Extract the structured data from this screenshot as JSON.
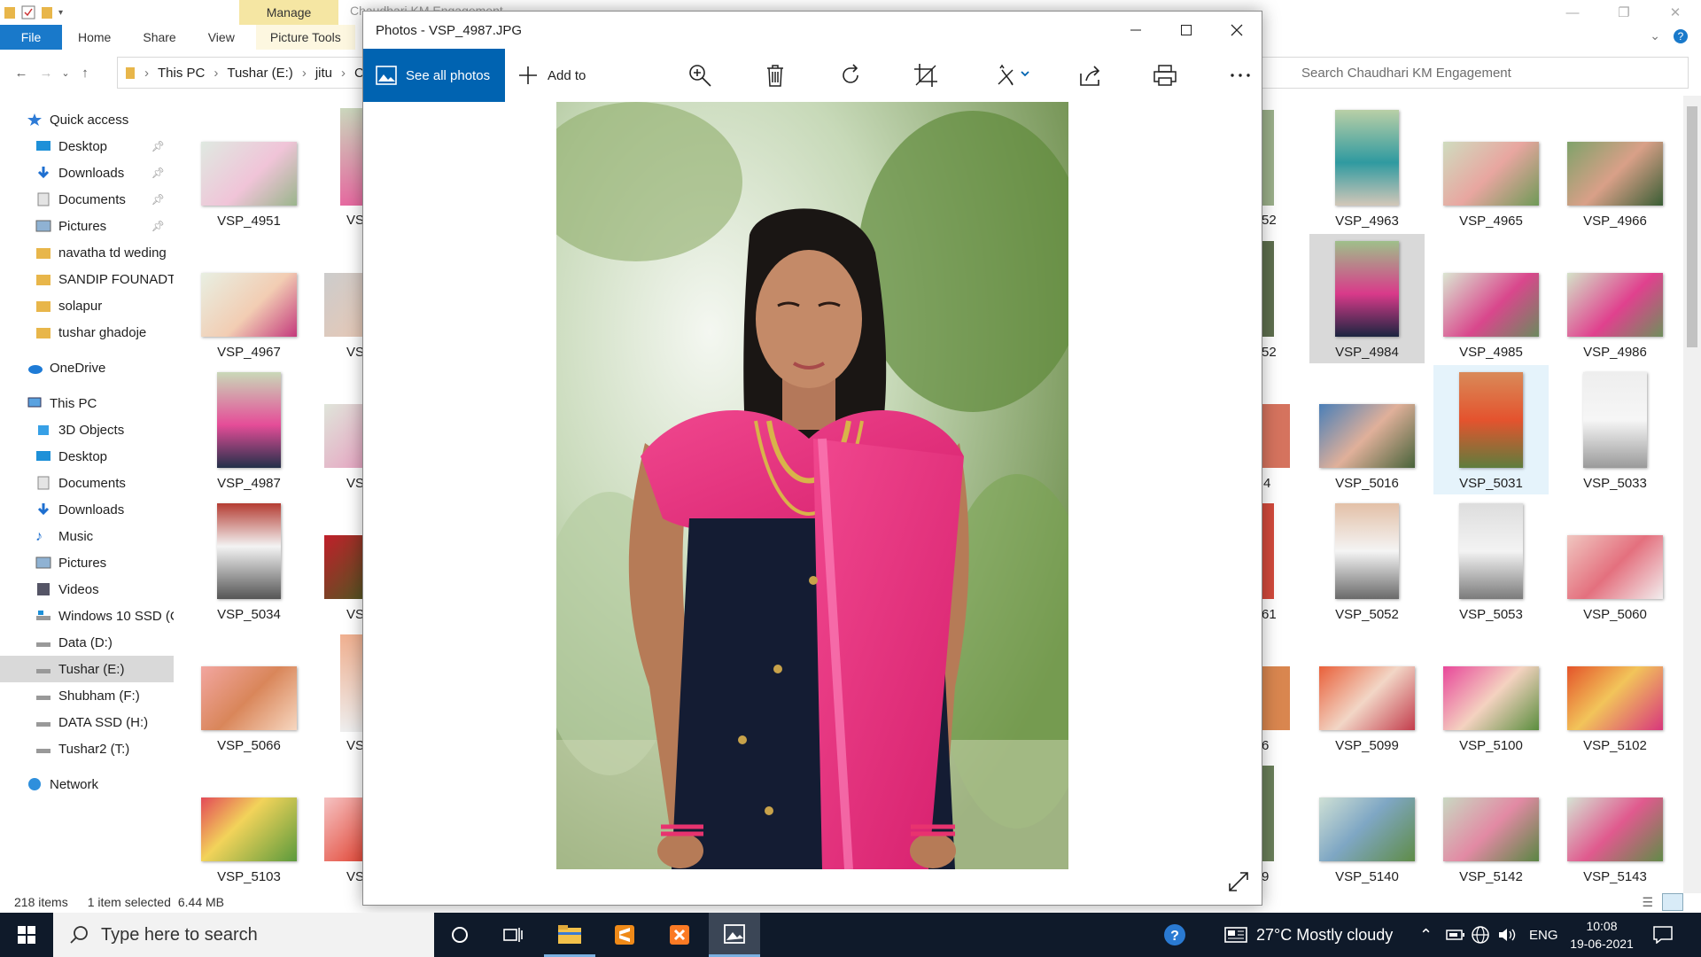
{
  "explorer": {
    "window_title": "Chaudhari KM Engagement",
    "ribbon": {
      "context_group": "Manage",
      "tabs": [
        "File",
        "Home",
        "Share",
        "View",
        "Picture Tools"
      ]
    },
    "address": [
      "This PC",
      "Tushar (E:)",
      "jitu",
      "C"
    ],
    "search_placeholder": "Search Chaudhari KM Engagement",
    "sidebar": {
      "quick_access": "Quick access",
      "qa_items": [
        "Desktop",
        "Downloads",
        "Documents",
        "Pictures",
        "navatha td weding",
        "SANDIP FOUNADTI(",
        "solapur",
        "tushar ghadoje"
      ],
      "onedrive": "OneDrive",
      "this_pc": "This PC",
      "pc_items": [
        "3D Objects",
        "Desktop",
        "Documents",
        "Downloads",
        "Music",
        "Pictures",
        "Videos",
        "Windows 10 SSD (C",
        "Data (D:)",
        "Tushar (E:)",
        "Shubham (F:)",
        "DATA SSD (H:)",
        "Tushar2 (T:)"
      ],
      "network": "Network"
    },
    "files_left": [
      "VSP_4951",
      "VSP_4967",
      "VSP_4987",
      "VSP_5034",
      "VSP_5066",
      "VSP_5103"
    ],
    "files_col2": [
      "VS",
      "VS",
      "VS",
      "VS",
      "VS",
      "VS"
    ],
    "files_right_partial": [
      "52",
      "52",
      "4",
      "61",
      "6",
      "9"
    ],
    "files_right": [
      [
        "VSP_4963",
        "VSP_4965",
        "VSP_4966"
      ],
      [
        "VSP_4984",
        "VSP_4985",
        "VSP_4986"
      ],
      [
        "VSP_5016",
        "VSP_5031",
        "VSP_5033"
      ],
      [
        "VSP_5052",
        "VSP_5053",
        "VSP_5060"
      ],
      [
        "VSP_5099",
        "VSP_5100",
        "VSP_5102"
      ],
      [
        "VSP_5140",
        "VSP_5142",
        "VSP_5143"
      ]
    ],
    "status": {
      "count": "218 items",
      "selected": "1 item selected",
      "size": "6.44 MB"
    }
  },
  "photos": {
    "title": "Photos - VSP_4987.JPG",
    "see_all": "See all photos",
    "add_to": "Add to"
  },
  "taskbar": {
    "search_placeholder": "Type here to search",
    "weather": "27°C  Mostly cloudy",
    "lang": "ENG",
    "time": "10:08",
    "date": "19-06-2021"
  }
}
